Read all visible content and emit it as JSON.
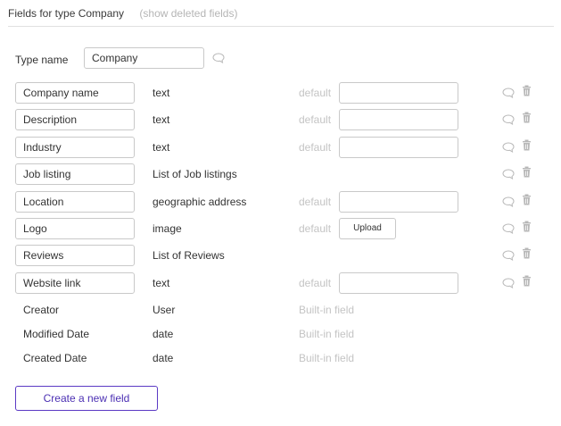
{
  "header": {
    "title": "Fields for type Company",
    "show_deleted": "(show deleted fields)"
  },
  "type_name": {
    "label": "Type name",
    "value": "Company"
  },
  "fields": [
    {
      "name": "Company name",
      "type": "text",
      "default_label": "default",
      "default_kind": "input"
    },
    {
      "name": "Description",
      "type": "text",
      "default_label": "default",
      "default_kind": "input"
    },
    {
      "name": "Industry",
      "type": "text",
      "default_label": "default",
      "default_kind": "input"
    },
    {
      "name": "Job listing",
      "type": "List of Job listings",
      "default_label": "",
      "default_kind": "none"
    },
    {
      "name": "Location",
      "type": "geographic address",
      "default_label": "default",
      "default_kind": "input"
    },
    {
      "name": "Logo",
      "type": "image",
      "default_label": "default",
      "default_kind": "upload",
      "upload_label": "Upload"
    },
    {
      "name": "Reviews",
      "type": "List of Reviews",
      "default_label": "",
      "default_kind": "none"
    },
    {
      "name": "Website link",
      "type": "text",
      "default_label": "default",
      "default_kind": "input"
    }
  ],
  "builtin_fields": [
    {
      "name": "Creator",
      "type": "User",
      "note": "Built-in field"
    },
    {
      "name": "Modified Date",
      "type": "date",
      "note": "Built-in field"
    },
    {
      "name": "Created Date",
      "type": "date",
      "note": "Built-in field"
    }
  ],
  "create_button": "Create a new field",
  "colors": {
    "accent": "#5b39c4",
    "muted": "#c4c4c4",
    "icon": "#b8b8b8"
  },
  "icons": {
    "comment": "speech-bubble-icon",
    "delete": "trash-icon"
  }
}
